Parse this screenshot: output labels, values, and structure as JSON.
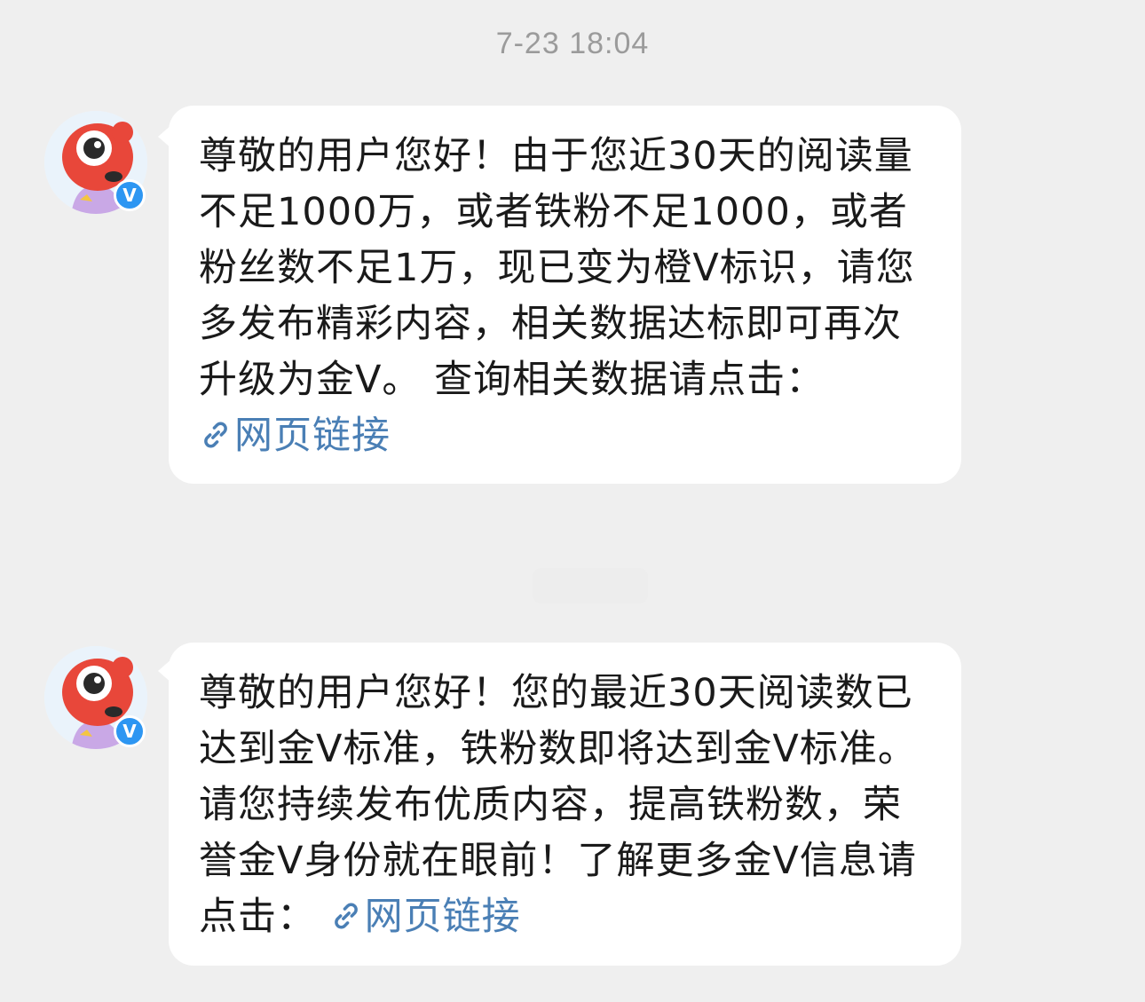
{
  "timestamp": "7-23 18:04",
  "messages": [
    {
      "text": "尊敬的用户您好！由于您近30天的阅读量不足1000万，或者铁粉不足1000，或者粉丝数不足1万，现已变为橙V标识，请您多发布精彩内容，相关数据达标即可再次升级为金V。 查询相关数据请点击：",
      "link_label": "网页链接",
      "verified_badge": "V"
    },
    {
      "text": "尊敬的用户您好！您的最近30天阅读数已达到金V标准，铁粉数即将达到金V标准。请您持续发布优质内容，提高铁粉数，荣誉金V身份就在眼前！了解更多金V信息请点击： ",
      "link_label": "网页链接",
      "verified_badge": "V"
    }
  ],
  "icons": {
    "avatar": "weibo-mascot-avatar-icon",
    "badge": "verified-v-badge-icon",
    "link": "link-chain-icon"
  },
  "colors": {
    "background": "#efefef",
    "bubble": "#ffffff",
    "link": "#4a7fb5",
    "badge": "#2d96f2",
    "mascot": "#e8473a"
  }
}
